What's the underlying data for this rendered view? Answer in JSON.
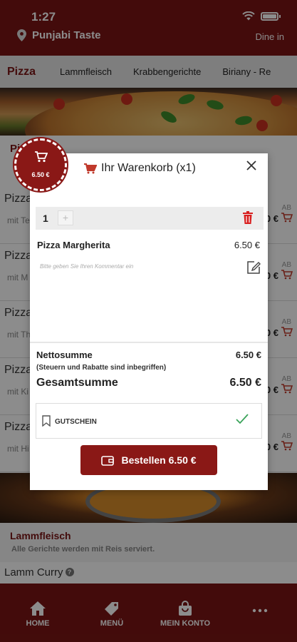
{
  "status_bar": {
    "time": "1:27"
  },
  "header": {
    "restaurant_name": "Punjabi Taste",
    "service_mode": "Dine in"
  },
  "category_tabs": {
    "active": "Pizza",
    "items": [
      "Lammfleisch",
      "Krabbengerichte",
      "Biriany - Re"
    ]
  },
  "background_menu": {
    "rows": [
      {
        "name": "Pizza",
        "sub": "mit Te",
        "availability": "AB",
        "price": "0 €"
      },
      {
        "name": "Pizza",
        "sub": "mit M",
        "availability": "AB",
        "price": "0 €"
      },
      {
        "name": "Pizza",
        "sub": "mit Th",
        "availability": "AB",
        "price": "0 €"
      },
      {
        "name": "Pizza",
        "sub": "mit Ki",
        "availability": "AB",
        "price": "0 €"
      },
      {
        "name": "Pizza",
        "sub": "mit Hi",
        "availability": "AB",
        "price": "0 €"
      }
    ],
    "selected_section_title": "Pi",
    "lamm_section": {
      "title": "Lammfleisch",
      "subtitle": "Alle Gerichte werden mit Reis serviert."
    },
    "lamm_curry": {
      "name": "Lamm Curry",
      "info_symbol": "?"
    }
  },
  "cart": {
    "badge_price": "6.50 €",
    "title": "Ihr Warenkorb (x1)",
    "quantity": "1",
    "plus_symbol": "+",
    "item_name": "Pizza Margherita",
    "item_price": "6.50 €",
    "comment_placeholder": "Bitte geben Sie Ihren Kommentar ein",
    "net_label": "Nettosumme",
    "net_value": "6.50 €",
    "tax_note": "(Steuern und Rabatte sind inbegriffen)",
    "total_label": "Gesamtsumme",
    "total_value": "6.50 €",
    "voucher_label": "GUTSCHEIN",
    "order_button_label": "Bestellen 6.50 €"
  },
  "bottom_nav": {
    "home": "HOME",
    "menu": "MENÜ",
    "account": "MEIN KONTO"
  },
  "colors": {
    "brand": "#7a1514",
    "accent": "#8a1816",
    "check": "#3aa35a",
    "trash": "#d81e1e"
  }
}
